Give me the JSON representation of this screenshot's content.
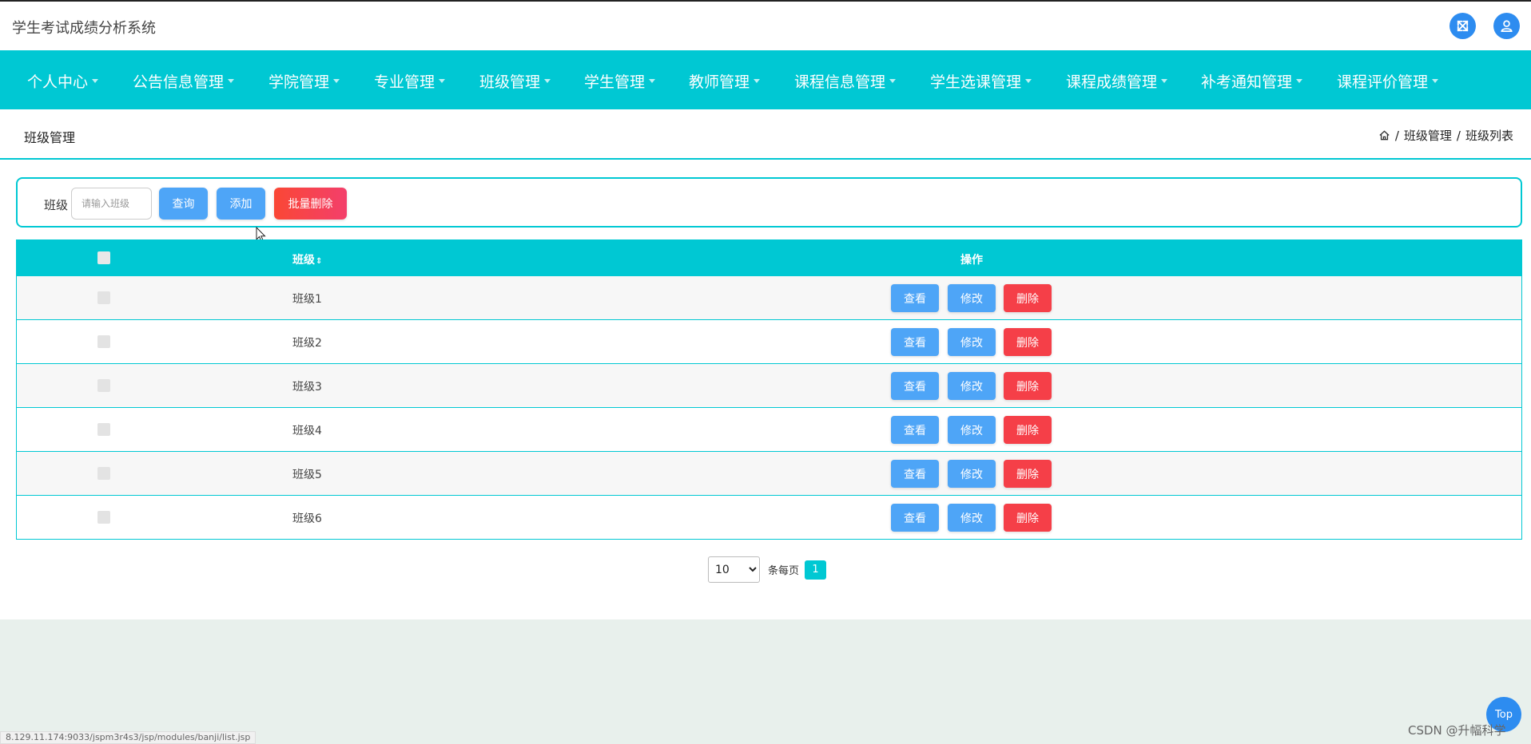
{
  "header": {
    "title": "学生考试成绩分析系统",
    "fullscreen_icon": "expand-icon",
    "user_icon": "user-icon",
    "accent": "#2d8cf0"
  },
  "nav": {
    "color": "#00c8d3",
    "items": [
      {
        "label": "个人中心"
      },
      {
        "label": "公告信息管理"
      },
      {
        "label": "学院管理"
      },
      {
        "label": "专业管理"
      },
      {
        "label": "班级管理"
      },
      {
        "label": "学生管理"
      },
      {
        "label": "教师管理"
      },
      {
        "label": "课程信息管理"
      },
      {
        "label": "学生选课管理"
      },
      {
        "label": "课程成绩管理"
      },
      {
        "label": "补考通知管理"
      },
      {
        "label": "课程评价管理"
      }
    ]
  },
  "page": {
    "title": "班级管理",
    "breadcrumb": [
      "班级管理",
      "班级列表"
    ],
    "breadcrumb_sep": "/"
  },
  "search": {
    "label": "班级",
    "placeholder": "请输入班级",
    "query_label": "查询",
    "add_label": "添加",
    "batch_delete_label": "批量删除"
  },
  "table": {
    "columns": {
      "name": "班级",
      "sort_glyph": "⇕",
      "ops": "操作"
    },
    "rows": [
      {
        "name": "班级1"
      },
      {
        "name": "班级2"
      },
      {
        "name": "班级3"
      },
      {
        "name": "班级4"
      },
      {
        "name": "班级5"
      },
      {
        "name": "班级6"
      }
    ],
    "row_actions": {
      "view": "查看",
      "edit": "修改",
      "delete": "删除"
    },
    "colors": {
      "blue": "#4ea5f7",
      "red": "#f53f48"
    }
  },
  "pagination": {
    "page_size": "10",
    "page_size_options": [
      "10"
    ],
    "per_page_label": "条每页",
    "current_page": "1"
  },
  "footer": {
    "status_url": "8.129.11.174:9033/jspm3r4s3/jsp/modules/banji/list.jsp",
    "top_label": "Top",
    "watermark": "CSDN @升幅科学"
  }
}
